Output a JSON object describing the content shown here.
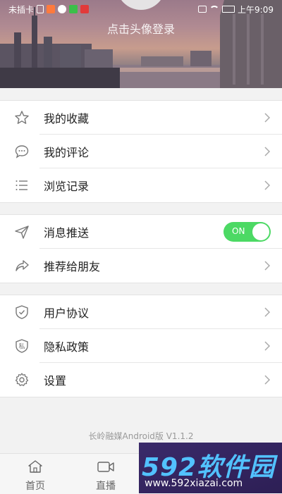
{
  "status_bar": {
    "carrier": "未插卡",
    "time": "上午9:09"
  },
  "profile": {
    "login_prompt": "点击头像登录"
  },
  "menu": {
    "group1": [
      {
        "label": "我的收藏",
        "icon": "star-icon"
      },
      {
        "label": "我的评论",
        "icon": "comment-icon"
      },
      {
        "label": "浏览记录",
        "icon": "list-icon"
      }
    ],
    "group2": [
      {
        "label": "消息推送",
        "icon": "send-icon",
        "toggle": "ON"
      },
      {
        "label": "推荐给朋友",
        "icon": "share-icon"
      }
    ],
    "group3": [
      {
        "label": "用户协议",
        "icon": "shield-check-icon"
      },
      {
        "label": "隐私政策",
        "icon": "privacy-shield-icon",
        "icon_text": "私"
      },
      {
        "label": "设置",
        "icon": "gear-icon"
      }
    ]
  },
  "version": "长岭融媒Android版 V1.1.2",
  "tabbar": {
    "tabs": [
      {
        "label": "首页",
        "icon": "home-icon"
      },
      {
        "label": "直播",
        "icon": "camera-icon"
      }
    ]
  },
  "watermark": {
    "brand": "592软件园",
    "url": "www.592xiazai.com"
  },
  "colors": {
    "toggle_on": "#4cd964",
    "watermark_bg": "#2d1f55",
    "watermark_brand": "#52c2ff"
  }
}
